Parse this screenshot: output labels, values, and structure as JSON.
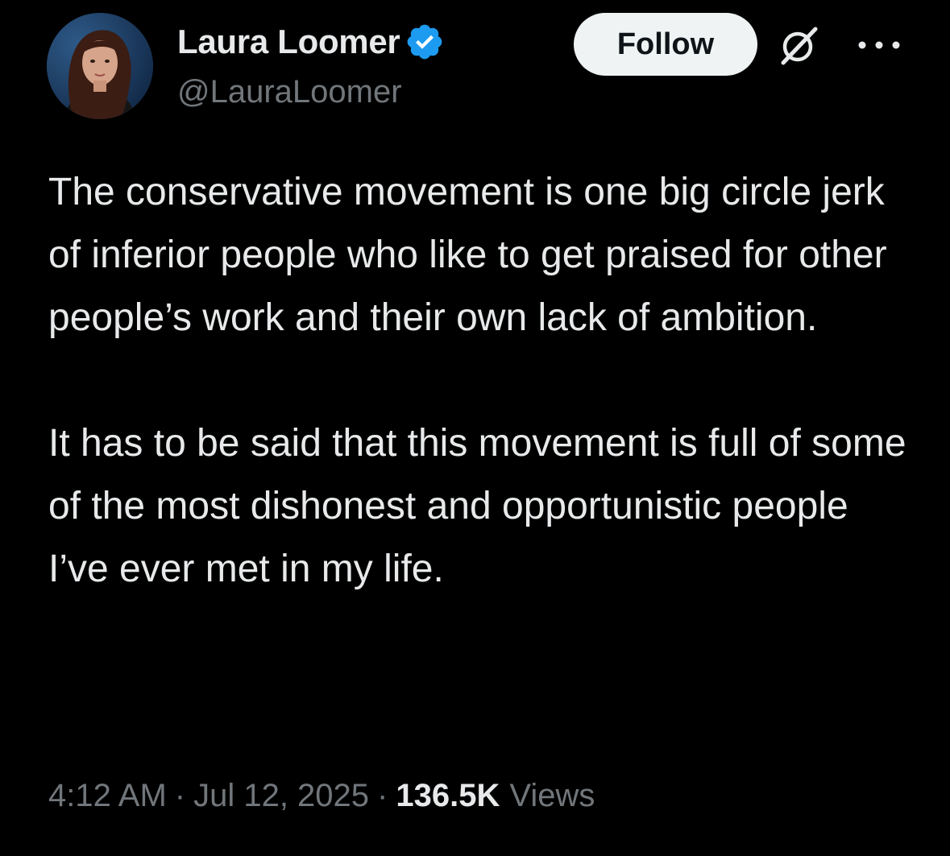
{
  "author": {
    "display_name": "Laura Loomer",
    "handle": "@LauraLoomer",
    "verified": true,
    "verified_color": "#1d9bf0"
  },
  "actions": {
    "follow_label": "Follow",
    "grok_icon": "grok-icon",
    "more_icon": "more-horizontal-icon"
  },
  "tweet": {
    "paragraphs": [
      "The conservative movement is one big circle jerk of inferior people who like to get praised for other people’s work and their own lack of ambition.",
      "It has to be said that this movement is full of some of the most dishonest and opportunistic people I’ve ever met in my life."
    ]
  },
  "meta": {
    "time": "4:12 AM",
    "separator": "·",
    "date": "Jul 12, 2025",
    "views_count": "136.5K",
    "views_label": "Views"
  },
  "colors": {
    "background": "#000000",
    "text_primary": "#e7e9ea",
    "text_secondary": "#71767b",
    "follow_bg": "#eff3f4",
    "follow_text": "#0f1419"
  }
}
